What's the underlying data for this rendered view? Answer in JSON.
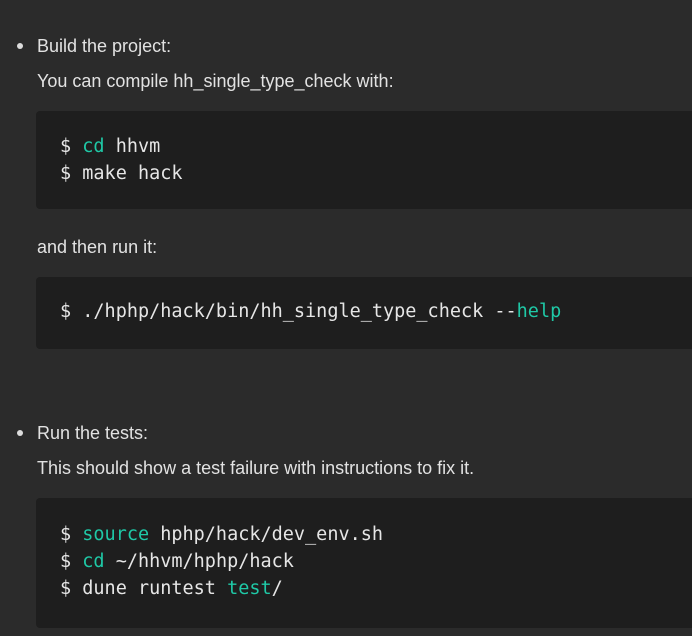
{
  "steps": [
    {
      "heading": "Build the project:",
      "description": "You can compile hh_single_type_check with:",
      "code_block_1": [
        {
          "prompt": "$ ",
          "keyword": "cd",
          "rest": " hhvm"
        },
        {
          "prompt": "$ ",
          "keyword": "",
          "rest": "make hack"
        }
      ],
      "followup": "and then run it:",
      "code_block_2": [
        {
          "prompt": "$ ",
          "before": "./hphp/hack/bin/hh_single_type_check --",
          "keyword": "help",
          "after": ""
        }
      ]
    },
    {
      "heading": "Run the tests:",
      "description": "This should show a test failure with instructions to fix it.",
      "code_block": [
        {
          "prompt": "$ ",
          "keyword": "source",
          "rest": " hphp/hack/dev_env.sh"
        },
        {
          "prompt": "$ ",
          "keyword": "cd",
          "rest": " ~/hhvm/hphp/hack"
        },
        {
          "prompt": "$ ",
          "before": "dune runtest ",
          "keyword": "test",
          "after": "/"
        }
      ]
    }
  ],
  "colors": {
    "background": "#2b2b2b",
    "code_background": "#1e1e1e",
    "text": "#e2e2e2",
    "keyword": "#1fc8a6"
  }
}
